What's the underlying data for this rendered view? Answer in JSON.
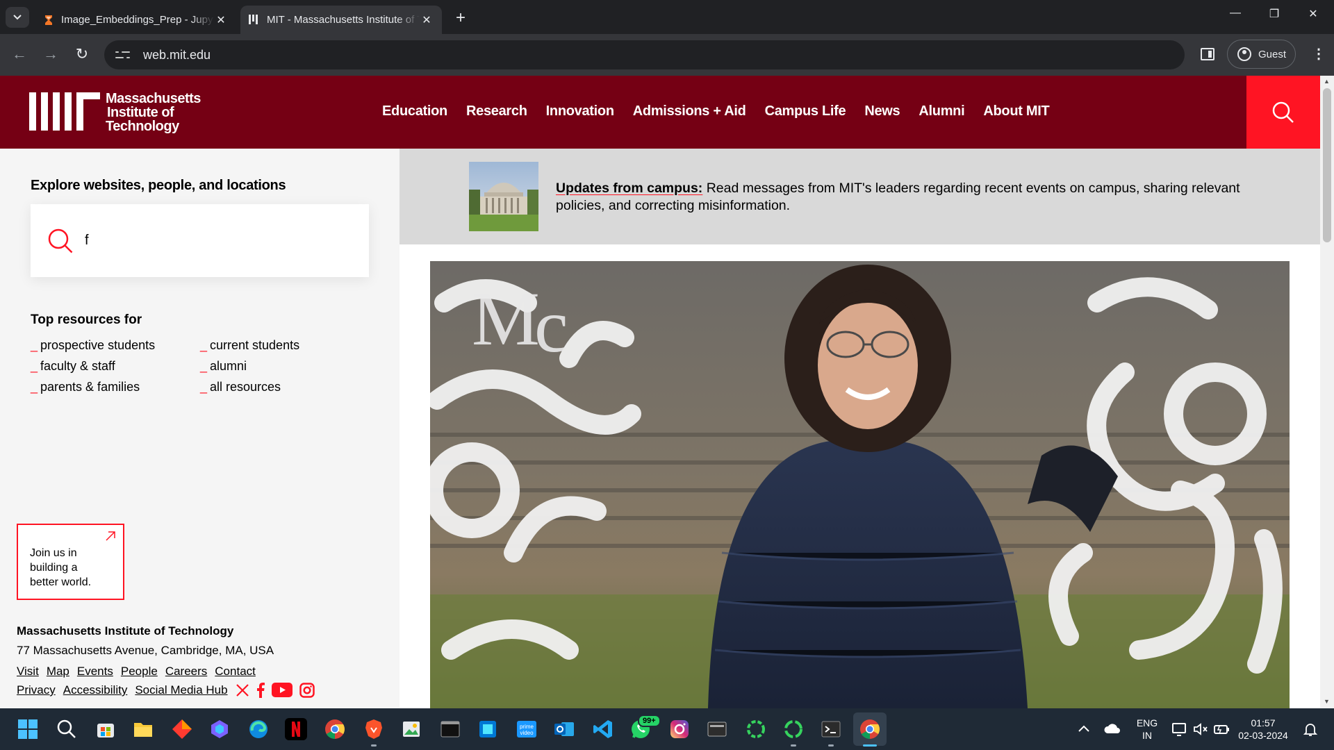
{
  "browser": {
    "tabs": [
      {
        "title": "Image_Embeddings_Prep - Jupyter",
        "active": false
      },
      {
        "title": "MIT - Massachusetts Institute of Technology",
        "active": true
      }
    ],
    "url": "web.mit.edu",
    "profile_label": "Guest"
  },
  "site": {
    "wordmark": [
      "Massachusetts",
      "Institute of",
      "Technology"
    ],
    "nav": [
      "Education",
      "Research",
      "Innovation",
      "Admissions + Aid",
      "Campus Life",
      "News",
      "Alumni",
      "About MIT"
    ],
    "explore_title": "Explore websites, people, and locations",
    "search_value": "f",
    "top_resources_title": "Top resources for",
    "resources": [
      "prospective students",
      "current students",
      "faculty & staff",
      "alumni",
      "parents & families",
      "all resources"
    ],
    "join_text": [
      "Join us in",
      "building a",
      "better world."
    ],
    "footer": {
      "name": "Massachusetts Institute of Technology",
      "address": "77 Massachusetts Avenue, Cambridge, MA, USA",
      "links": [
        "Visit",
        "Map",
        "Events",
        "People",
        "Careers",
        "Contact"
      ],
      "links2": [
        "Privacy",
        "Accessibility",
        "Social Media Hub"
      ]
    },
    "updates": {
      "heading": "Updates from campus:",
      "body": " Read messages from MIT's leaders regarding recent events on campus, sharing relevant policies, and correcting misinformation."
    },
    "colors": {
      "brand": "#750014",
      "accent": "#ff1423"
    }
  },
  "taskbar": {
    "whatsapp_badge": "99+",
    "lang": [
      "ENG",
      "IN"
    ],
    "time": "01:57",
    "date": "02-03-2024"
  }
}
